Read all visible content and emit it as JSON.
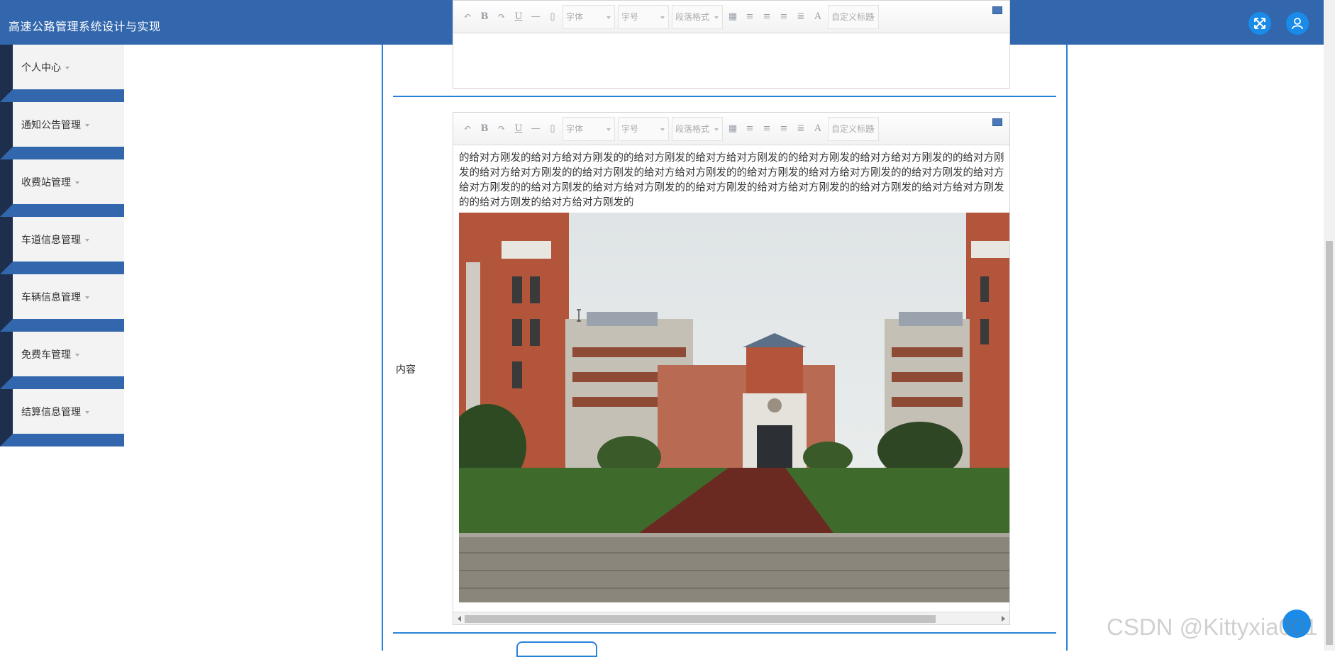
{
  "header": {
    "title": "高速公路管理系统设计与实现",
    "fullscreen_icon": "expand-icon",
    "user_icon": "user-icon"
  },
  "sidebar": {
    "items": [
      {
        "label": "个人中心"
      },
      {
        "label": "通知公告管理"
      },
      {
        "label": "收费站管理"
      },
      {
        "label": "车道信息管理"
      },
      {
        "label": "车辆信息管理"
      },
      {
        "label": "免费车管理"
      },
      {
        "label": "结算信息管理"
      }
    ]
  },
  "editor_toolbar": {
    "font_family": "字体",
    "font_size": "字号",
    "paragraph_format": "段落格式",
    "custom_heading": "自定义标题",
    "bold": "B",
    "underline": "U",
    "text_color": "A"
  },
  "form": {
    "content_label": "内容",
    "content_text": "的给对方刚发的给对方给对方刚发的的给对方刚发的给对方给对方刚发的的给对方刚发的给对方给对方刚发的的给对方刚发的给对方给对方刚发的的给对方刚发的给对方给对方刚发的的给对方刚发的给对方给对方刚发的的给对方刚发的给对方给对方刚发的的给对方刚发的给对方给对方刚发的的给对方刚发的给对方给对方刚发的的给对方刚发的给对方给对方刚发的的给对方刚发的给对方给对方刚发的"
  },
  "watermark": "CSDN @Kittyxia001",
  "colors": {
    "header_blue": "#3267ad",
    "sidebar_dark": "#1d2f4d",
    "frame_blue": "#2a82d8",
    "button_blue": "#1a8be8"
  }
}
